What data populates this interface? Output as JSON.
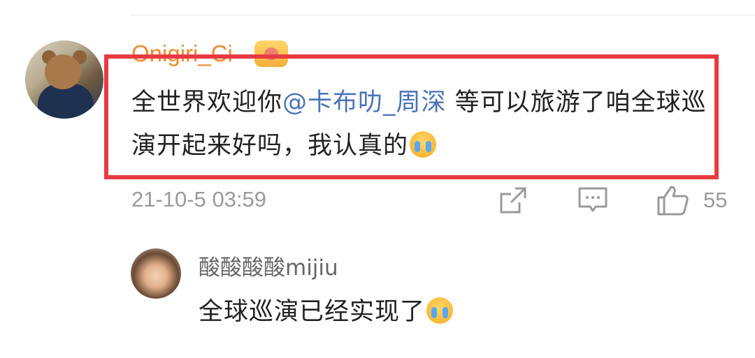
{
  "comment": {
    "username": "Onigiri_Ci",
    "text_part1": "全世界欢迎你",
    "mention": "@卡布叻_周深",
    "text_part2": " 等可以旅游了咱全球巡演开起来好吗，我认真的",
    "emoji": "crying-face-icon",
    "timestamp": "21-10-5 03:59",
    "like_count": "55"
  },
  "reply": {
    "username": "酸酸酸酸mijiu",
    "text": "全球巡演已经实现了",
    "emoji": "crying-face-icon"
  },
  "colors": {
    "username": "#f08a2a",
    "mention": "#4b73b8",
    "highlight_border": "#e83a42",
    "meta": "#9a9a9a"
  }
}
